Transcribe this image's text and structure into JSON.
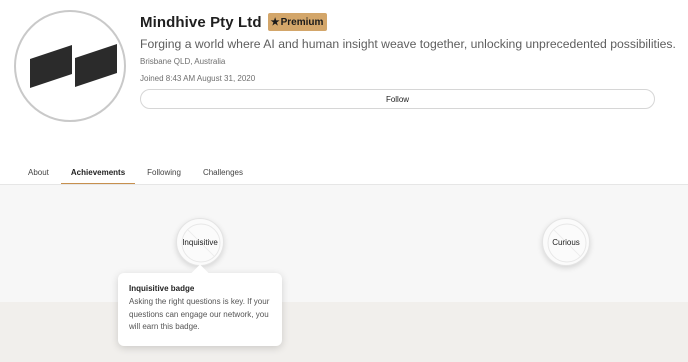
{
  "profile": {
    "name": "Mindhive Pty Ltd",
    "premium_label": "Premium",
    "premium_icon": "star-icon",
    "tagline": "Forging a world where AI and human insight weave together, unlocking unprecedented possibilities.",
    "location": "Brisbane QLD, Australia",
    "joined": "Joined 8:43 AM August 31, 2020",
    "follow_label": "Follow"
  },
  "tabs": [
    {
      "label": "About",
      "active": false
    },
    {
      "label": "Achievements",
      "active": true
    },
    {
      "label": "Following",
      "active": false
    },
    {
      "label": "Challenges",
      "active": false
    }
  ],
  "badges": [
    {
      "label": "Inquisitive"
    },
    {
      "label": "Curious"
    }
  ],
  "tooltip": {
    "title": "Inquisitive badge",
    "text": "Asking the right questions is key. If your questions can engage our network, you will earn this badge."
  },
  "colors": {
    "accent": "#d3a66a",
    "tab_underline": "#c7904e",
    "logo": "#2b2b2b"
  }
}
